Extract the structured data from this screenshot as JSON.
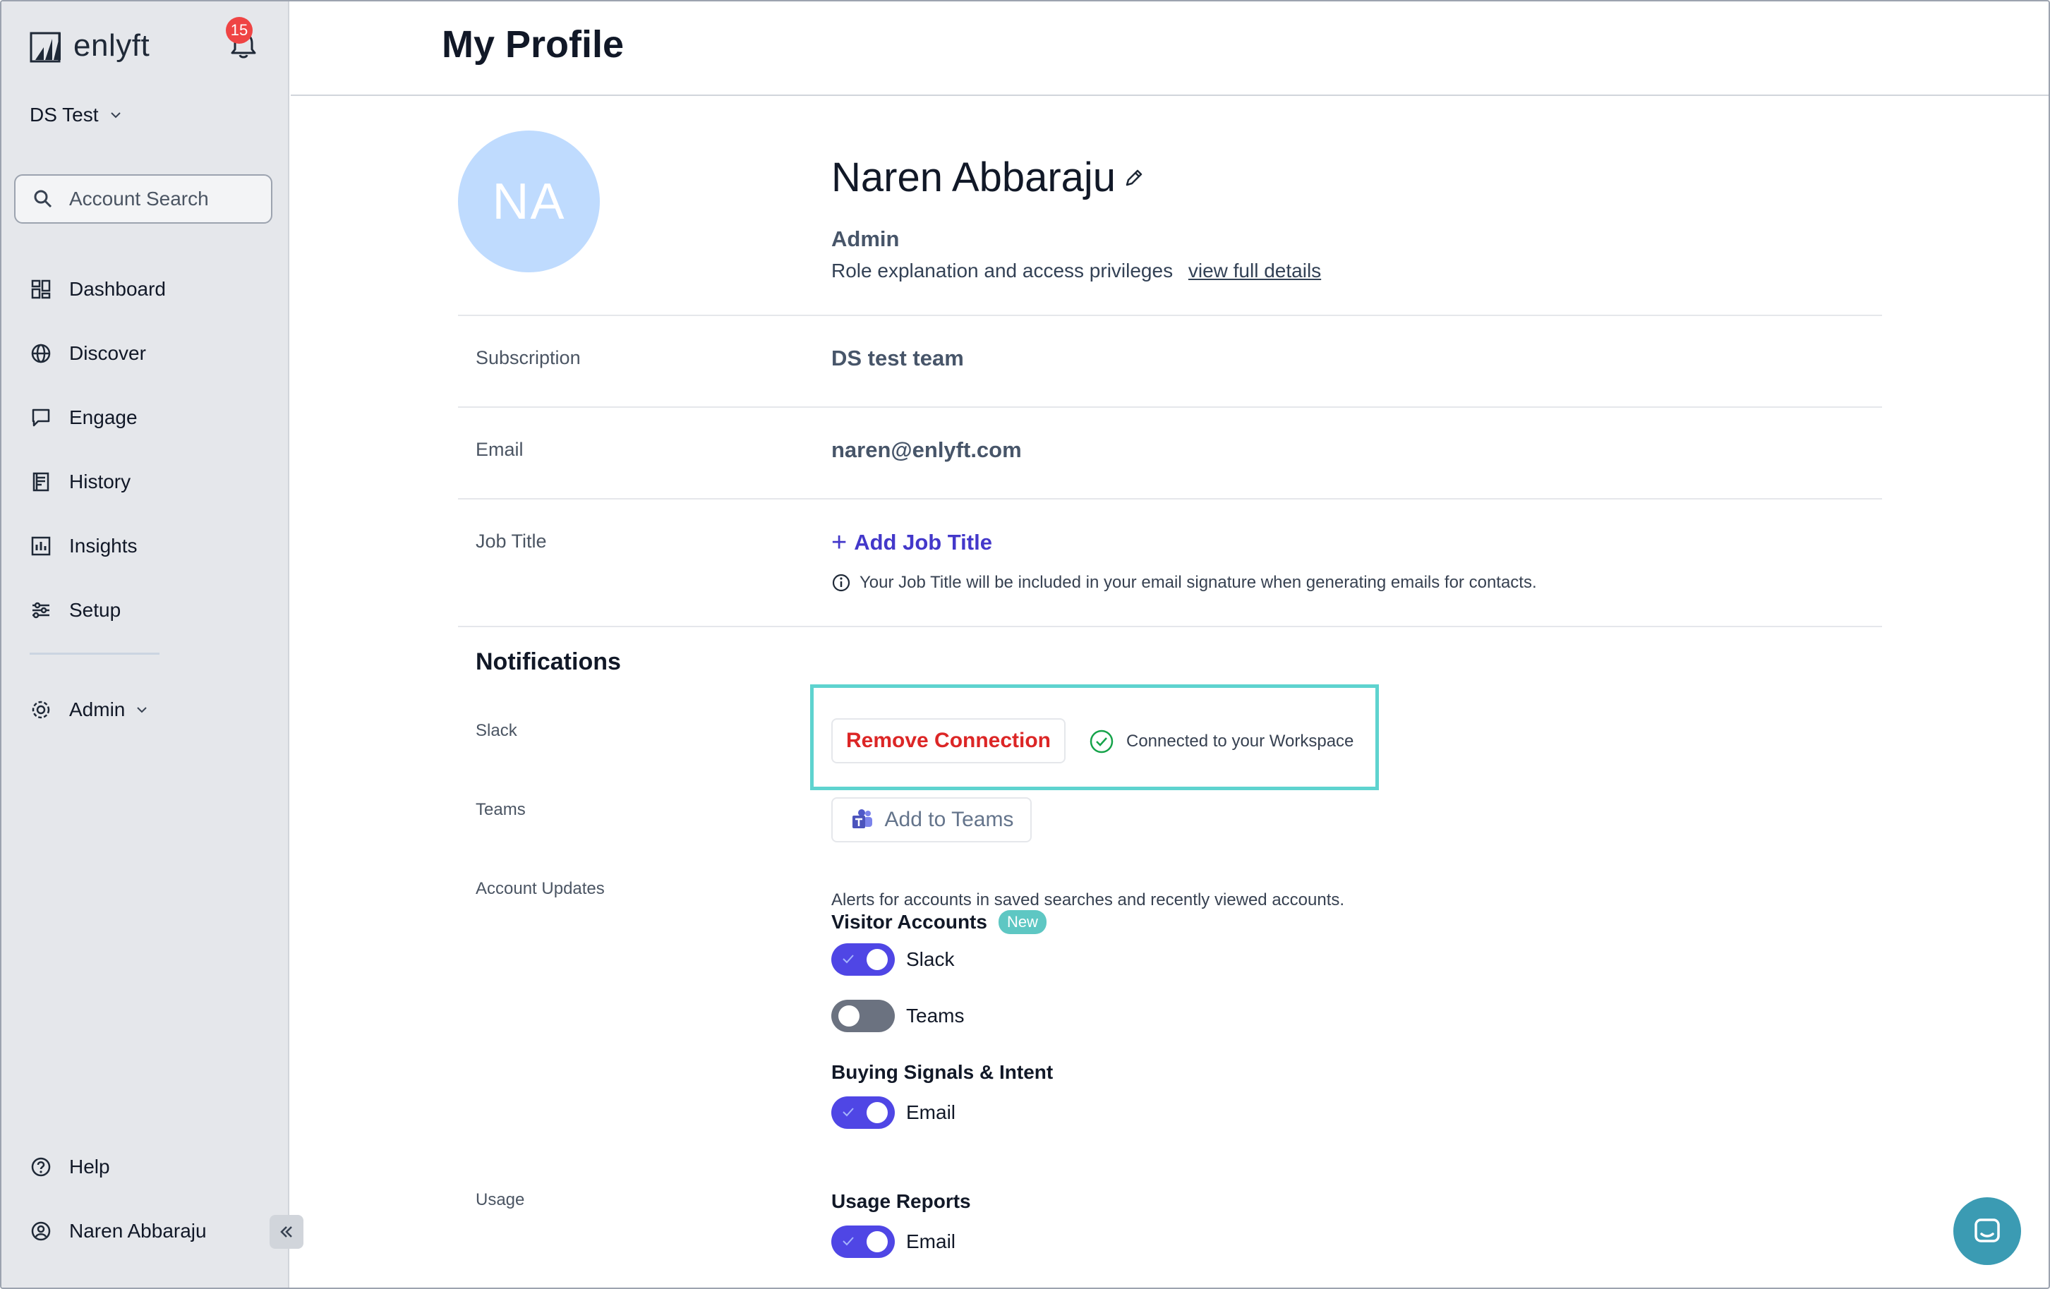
{
  "app": {
    "brand": "enlyft",
    "notification_count": "15",
    "workspace": "DS Test"
  },
  "sidebar": {
    "search_placeholder": "Account Search",
    "items": [
      {
        "label": "Dashboard",
        "icon": "dashboard-icon"
      },
      {
        "label": "Discover",
        "icon": "globe-icon"
      },
      {
        "label": "Engage",
        "icon": "chat-icon"
      },
      {
        "label": "History",
        "icon": "history-icon"
      },
      {
        "label": "Insights",
        "icon": "chart-icon"
      },
      {
        "label": "Setup",
        "icon": "sliders-icon"
      }
    ],
    "admin_label": "Admin",
    "help_label": "Help",
    "user_label": "Naren Abbaraju"
  },
  "header": {
    "title": "My Profile"
  },
  "profile": {
    "initials": "NA",
    "name": "Naren Abbaraju",
    "role": "Admin",
    "role_description": "Role explanation and access privileges",
    "role_link": "view full details",
    "subscription_label": "Subscription",
    "subscription_value": "DS test team",
    "email_label": "Email",
    "email_value": "naren@enlyft.com",
    "job_title_label": "Job Title",
    "add_job_title": "Add Job Title",
    "job_title_hint": "Your Job Title will be included in your email signature when generating emails for contacts."
  },
  "notifications": {
    "title": "Notifications",
    "slack_label": "Slack",
    "remove_connection": "Remove Connection",
    "connected_text": "Connected to your Workspace",
    "teams_label": "Teams",
    "add_to_teams": "Add to Teams",
    "account_updates_label": "Account Updates",
    "account_updates_desc": "Alerts for accounts in saved searches and recently viewed accounts.",
    "visitor_accounts": {
      "title": "Visitor Accounts",
      "badge": "New",
      "slack_label": "Slack",
      "slack_on": true,
      "teams_label": "Teams",
      "teams_on": false
    },
    "buying_signals": {
      "title": "Buying Signals & Intent",
      "email_label": "Email",
      "email_on": true
    },
    "usage_label": "Usage",
    "usage_reports": {
      "title": "Usage Reports",
      "email_label": "Email",
      "email_on": true
    }
  },
  "colors": {
    "accent": "#4f46e5",
    "danger": "#dc2626",
    "highlight": "#5ed3cf",
    "avatar_bg": "#bfdbfe",
    "sidebar_bg": "#e5e7eb"
  }
}
